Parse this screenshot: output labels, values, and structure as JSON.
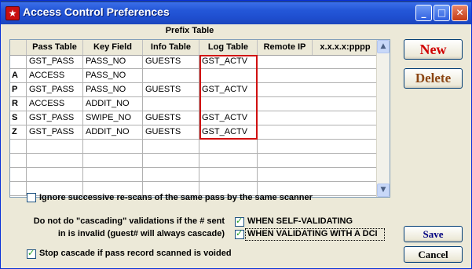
{
  "window": {
    "title": "Access Control Preferences",
    "minimize": "_",
    "maximize": "□",
    "close": "✕",
    "app_icon": "star-icon"
  },
  "grid": {
    "title": "Prefix Table",
    "columns": [
      "Pass Table",
      "Key Field",
      "Info Table",
      "Log Table",
      "Remote IP",
      "x.x.x.x:pppp"
    ],
    "rows": [
      {
        "key": "",
        "pass": "GST_PASS",
        "field": "PASS_NO",
        "info": "GUESTS",
        "log": "GST_ACTV",
        "remote": ""
      },
      {
        "key": "A",
        "pass": "ACCESS",
        "field": "PASS_NO",
        "info": "",
        "log": "",
        "remote": ""
      },
      {
        "key": "P",
        "pass": "GST_PASS",
        "field": "PASS_NO",
        "info": "GUESTS",
        "log": "GST_ACTV",
        "remote": ""
      },
      {
        "key": "R",
        "pass": "ACCESS",
        "field": "ADDIT_NO",
        "info": "",
        "log": "",
        "remote": ""
      },
      {
        "key": "S",
        "pass": "GST_PASS",
        "field": "SWIPE_NO",
        "info": "GUESTS",
        "log": "GST_ACTV",
        "remote": ""
      },
      {
        "key": "Z",
        "pass": "GST_PASS",
        "field": "ADDIT_NO",
        "info": "GUESTS",
        "log": "GST_ACTV",
        "remote": ""
      },
      {
        "key": "",
        "pass": "",
        "field": "",
        "info": "",
        "log": "",
        "remote": ""
      },
      {
        "key": "",
        "pass": "",
        "field": "",
        "info": "",
        "log": "",
        "remote": ""
      },
      {
        "key": "",
        "pass": "",
        "field": "",
        "info": "",
        "log": "",
        "remote": ""
      },
      {
        "key": "",
        "pass": "",
        "field": "",
        "info": "",
        "log": "",
        "remote": ""
      }
    ],
    "scroll_up": "▲",
    "scroll_down": "▼"
  },
  "buttons": {
    "new": "New",
    "delete": "Delete",
    "save": "Save",
    "cancel": "Cancel"
  },
  "options": {
    "ignore_rescans": {
      "label": "Ignore successive re-scans of the same pass by the same scanner",
      "checked": false
    },
    "cascade_note_line1": "Do not do \"cascading\" validations if the # sent",
    "cascade_note_line2": "in is invalid (guest# will always cascade)",
    "self_validating": {
      "label": "WHEN SELF-VALIDATING",
      "checked": true
    },
    "validating_dci": {
      "label": "WHEN VALIDATING WITH A DCI",
      "checked": true
    },
    "stop_cascade": {
      "label": "Stop cascade if pass record scanned is voided",
      "checked": true
    }
  },
  "colors": {
    "title_bar": "#2457d8",
    "new_button_text": "#d00000",
    "delete_button_text": "#8b4513",
    "save_button_text": "#000080",
    "highlight_border": "#d01010",
    "check_mark": "#21a121"
  }
}
